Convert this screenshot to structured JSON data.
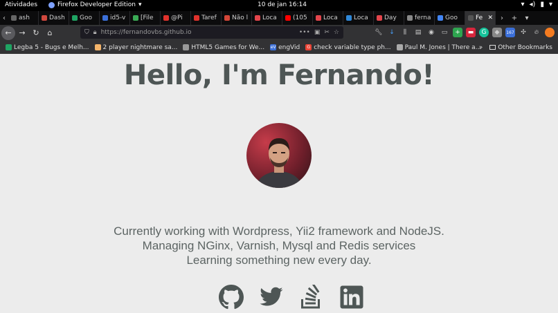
{
  "system_bar": {
    "activities": "Atividades",
    "app_name": "Firefox Developer Edition",
    "clock": "10 de jan  16:14"
  },
  "tabs": [
    {
      "label": "ash",
      "color": "#666"
    },
    {
      "label": "Dash",
      "color": "#d0483e"
    },
    {
      "label": "Goo",
      "color": "#1fa463"
    },
    {
      "label": "id5-v",
      "color": "#3b6fd8"
    },
    {
      "label": "[File",
      "color": "#3aaa55"
    },
    {
      "label": "@Pi",
      "color": "#e0322c"
    },
    {
      "label": "Taref",
      "color": "#e0322c"
    },
    {
      "label": "Não l",
      "color": "#d44638"
    },
    {
      "label": "Loca",
      "color": "#e3454c"
    },
    {
      "label": "(105",
      "color": "#ff0000"
    },
    {
      "label": "Loca",
      "color": "#e3454c"
    },
    {
      "label": "Loca",
      "color": "#2f88d8"
    },
    {
      "label": "Day",
      "color": "#e3454c"
    },
    {
      "label": "ferna",
      "color": "#888"
    },
    {
      "label": "Goo",
      "color": "#4285f4"
    },
    {
      "label": "Fe",
      "color": "#555",
      "active": true
    }
  ],
  "nav": {
    "url": "https://fernandovbs.github.io",
    "badge_count": "167"
  },
  "bookmarks": [
    {
      "label": "Legba 5 - Bugs e Melh...",
      "color": "#1fa463"
    },
    {
      "label": "2 player nightmare sa...",
      "color": "#f4b46a"
    },
    {
      "label": "HTML5 Games for We...",
      "color": "#999"
    },
    {
      "label": "engVid",
      "color": "#3b6fd8",
      "icon_text": "eV"
    },
    {
      "label": "check variable type ph...",
      "color": "#ea4335",
      "icon_text": "G"
    },
    {
      "label": "Paul M. Jones | There a...",
      "color": "#aaa"
    }
  ],
  "other_bookmarks": "Other Bookmarks",
  "page": {
    "heading": "Hello, I'm Fernando!",
    "lines": [
      "Currently working with Wordpress, Yii2 framework and NodeJS.",
      "Managing NGinx, Varnish, Mysql and Redis services",
      "Learning something new every day."
    ],
    "social_color": "#4e5655"
  },
  "icons": {
    "social": [
      "github-icon",
      "twitter-icon",
      "stackoverflow-icon",
      "linkedin-icon"
    ]
  }
}
